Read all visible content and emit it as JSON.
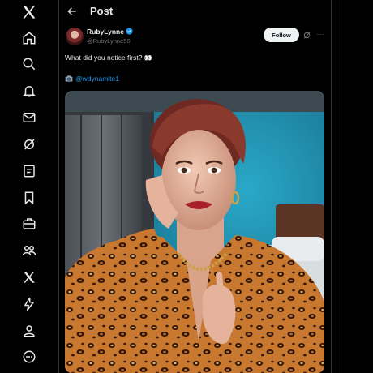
{
  "nav": {
    "items": [
      "x-logo-icon",
      "home-icon",
      "search-icon",
      "notifications-icon",
      "messages-icon",
      "grok-icon",
      "lists-icon",
      "bookmarks-icon",
      "jobs-icon",
      "communities-icon",
      "premium-icon",
      "verified-orgs-icon",
      "profile-icon",
      "more-icon"
    ]
  },
  "header": {
    "title": "Post"
  },
  "post": {
    "display_name": "RubyLynne",
    "handle": "@RubyLynne50",
    "follow_label": "Follow",
    "text": "What did you notice first?",
    "text_emoji": "👀",
    "credit": "@wdynamite1"
  },
  "colors": {
    "accent": "#1d9bf0",
    "background": "#000000",
    "text": "#e7e9ea",
    "muted": "#71767b",
    "wall": "#1e8fb0"
  }
}
